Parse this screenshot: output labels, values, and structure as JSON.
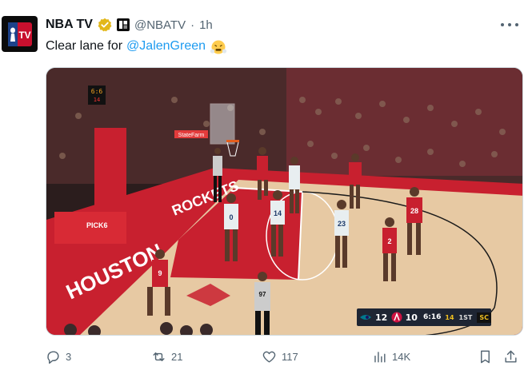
{
  "author": {
    "name": "NBA TV",
    "handle": "@NBATV",
    "separator": "·",
    "time": "1h",
    "avatar_icon": "nba-tv-logo",
    "verified_icon": "gold-verified-badge",
    "affiliate_icon": "nba-affiliate-badge"
  },
  "tweet": {
    "text_prefix": "Clear lane for",
    "mention": "@JalenGreen",
    "emoji": "steam-face-emoji"
  },
  "media": {
    "description_icon": "basketball-game-video",
    "scoreboard": {
      "away_team_icon": "hornets-logo",
      "away_score": "12",
      "home_team_icon": "rockets-logo",
      "home_score": "10",
      "clock": "6:16",
      "quarter": "1ST",
      "shot_clock": "14",
      "network": "SC"
    },
    "arena_text": {
      "baseline": "HOUSTON",
      "sideline": "ROCKETS",
      "shot_clock_display": "6:6",
      "shot_clock_sub": "14",
      "sponsor": "StateFarm",
      "stanchion": "PICK6"
    },
    "jersey_numbers": [
      "0",
      "14",
      "23",
      "28",
      "2",
      "97",
      "9"
    ]
  },
  "actions": {
    "replies": "3",
    "reposts": "21",
    "likes": "117",
    "views": "14K"
  },
  "colors": {
    "accent": "#1d9bf0",
    "muted": "#536471",
    "rockets_red": "#ce1141",
    "court": "#e7c9a3"
  }
}
